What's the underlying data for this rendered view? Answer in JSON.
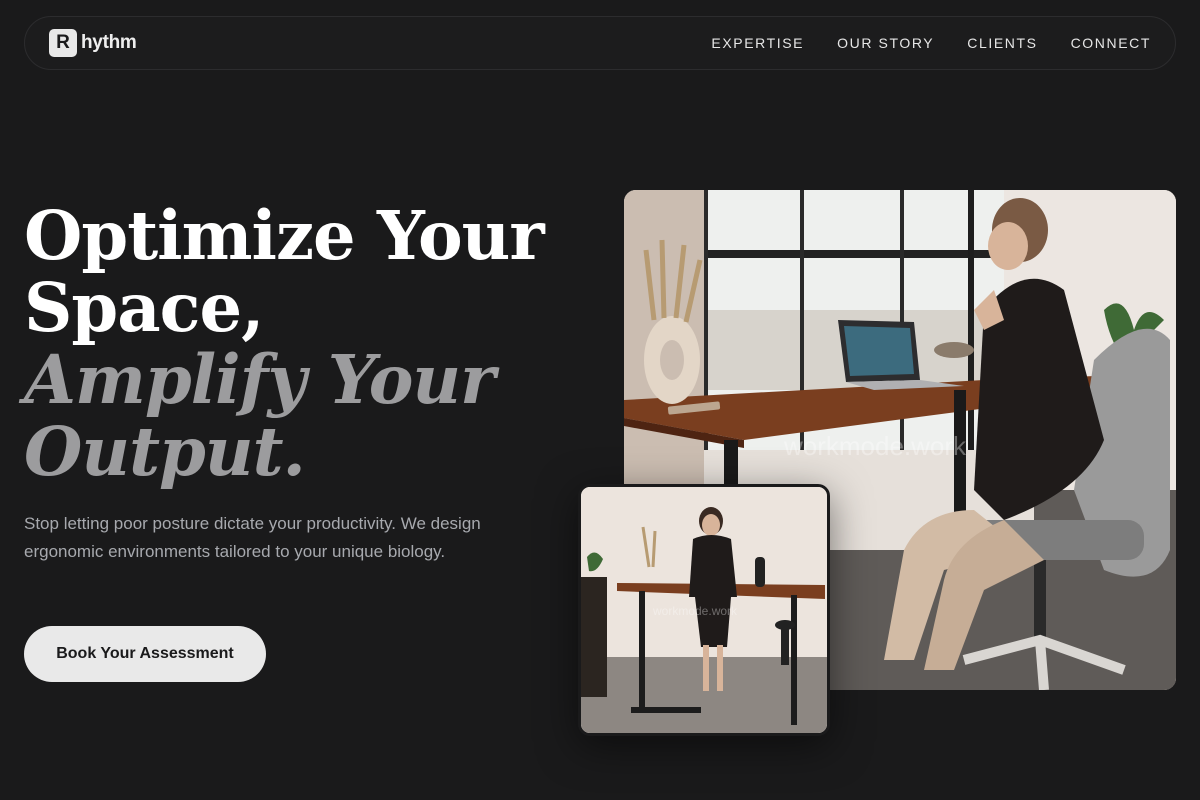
{
  "brand": {
    "mark": "R",
    "name": "hythm"
  },
  "nav": {
    "links": [
      {
        "label": "EXPERTISE"
      },
      {
        "label": "OUR STORY"
      },
      {
        "label": "CLIENTS"
      },
      {
        "label": "CONNECT"
      }
    ]
  },
  "hero": {
    "headline_line1": "Optimize Your",
    "headline_line2": "Space,",
    "headline_line3": "Amplify Your",
    "headline_line4": "Output.",
    "subcopy": "Stop letting poor posture dictate your productivity. We design ergonomic environments tailored to your unique biology.",
    "cta_label": "Book Your Assessment"
  },
  "images": {
    "main_watermark": "workmode.work",
    "small_watermark": "workmode.work"
  },
  "colors": {
    "background": "#1a1a1b",
    "headline_primary": "#ffffff",
    "headline_muted": "#9c9c9e",
    "cta_bg": "#e9e9e9"
  }
}
